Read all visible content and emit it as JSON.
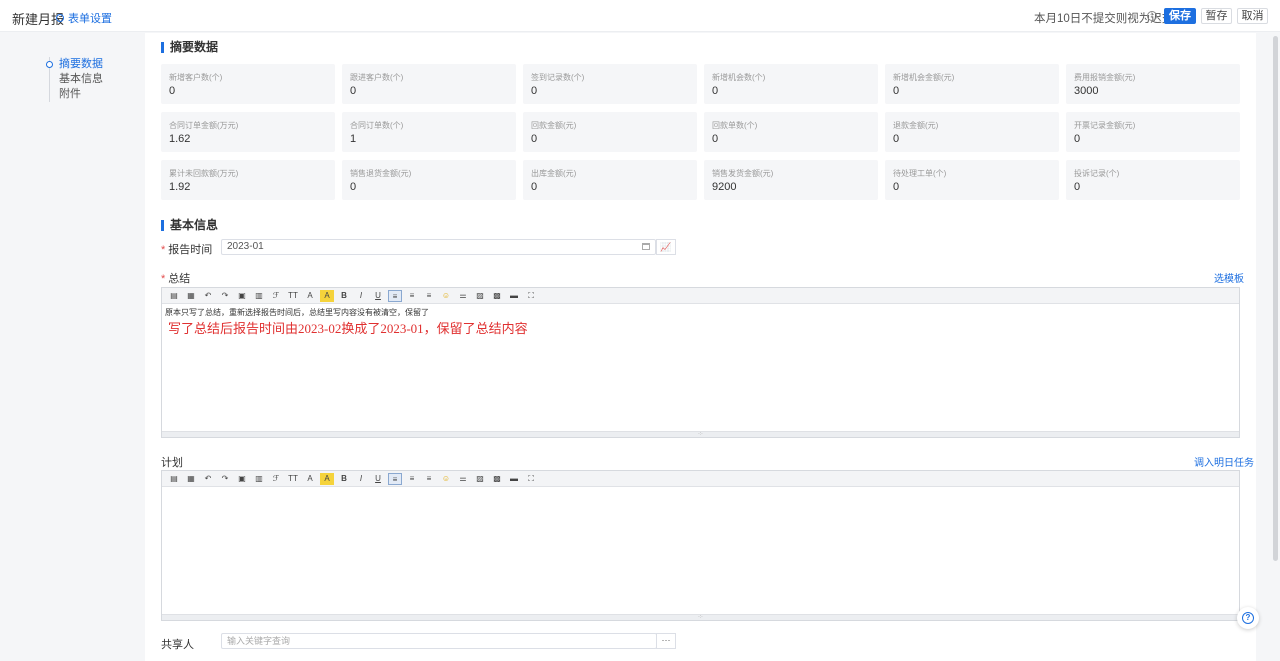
{
  "header": {
    "title": "新建月报",
    "form_settings": "表单设置",
    "notice": "本月10日不提交则视为迟交!",
    "save": "保存",
    "draft": "暂存",
    "cancel": "取消"
  },
  "nav": [
    "摘要数据",
    "基本信息",
    "附件"
  ],
  "summary": {
    "title": "摘要数据",
    "cards": [
      {
        "label": "新增客户数(个)",
        "value": "0"
      },
      {
        "label": "跟进客户数(个)",
        "value": "0"
      },
      {
        "label": "签到记录数(个)",
        "value": "0"
      },
      {
        "label": "新增机会数(个)",
        "value": "0"
      },
      {
        "label": "新增机会金额(元)",
        "value": "0"
      },
      {
        "label": "费用报销金额(元)",
        "value": "3000"
      },
      {
        "label": "合同订单金额(万元)",
        "value": "1.62"
      },
      {
        "label": "合同订单数(个)",
        "value": "1"
      },
      {
        "label": "回款金额(元)",
        "value": "0"
      },
      {
        "label": "回款单数(个)",
        "value": "0"
      },
      {
        "label": "退款金额(元)",
        "value": "0"
      },
      {
        "label": "开票记录金额(元)",
        "value": "0"
      },
      {
        "label": "累计未回款额(万元)",
        "value": "1.92"
      },
      {
        "label": "销售退货金额(元)",
        "value": "0"
      },
      {
        "label": "出库金额(元)",
        "value": "0"
      },
      {
        "label": "销售发货金额(元)",
        "value": "9200"
      },
      {
        "label": "待处理工单(个)",
        "value": "0"
      },
      {
        "label": "投诉记录(个)",
        "value": "0"
      }
    ]
  },
  "basic": {
    "title": "基本信息",
    "report_time_label": "报告时间",
    "report_time_value": "2023-01",
    "summary_label": "总结",
    "select_template": "选模板",
    "summary_line1": "原本只写了总结，重新选择报告时间后，总结里写内容没有被清空，保留了",
    "summary_line2": "写了总结后报告时间由2023-02换成了2023-01，保留了总结内容",
    "plan_label": "计划",
    "import_tasks": "调入明日任务",
    "share_label": "共享人",
    "share_placeholder": "输入关键字查询",
    "share_more": "···"
  },
  "toolbar_icons": [
    "source-icon",
    "template-icon",
    "undo-icon",
    "redo-icon",
    "paste-icon",
    "paste-text-icon",
    "format-painter-icon",
    "font-size-icon",
    "font-color-icon",
    "bg-color-icon",
    "bold-icon",
    "italic-icon",
    "underline-icon",
    "align-left-icon",
    "align-center-icon",
    "align-right-icon",
    "emoji-icon",
    "link-icon",
    "image-icon",
    "table-icon",
    "hr-icon",
    "fullscreen-icon"
  ],
  "toolbar_glyphs": [
    "▤",
    "▦",
    "↶",
    "↷",
    "▣",
    "▥",
    "ℱ",
    "TT",
    "A",
    "A",
    "B",
    "I",
    "U",
    "≡",
    "≡",
    "≡",
    "☺",
    "⚌",
    "▨",
    "▩",
    "▬",
    "⛶"
  ]
}
